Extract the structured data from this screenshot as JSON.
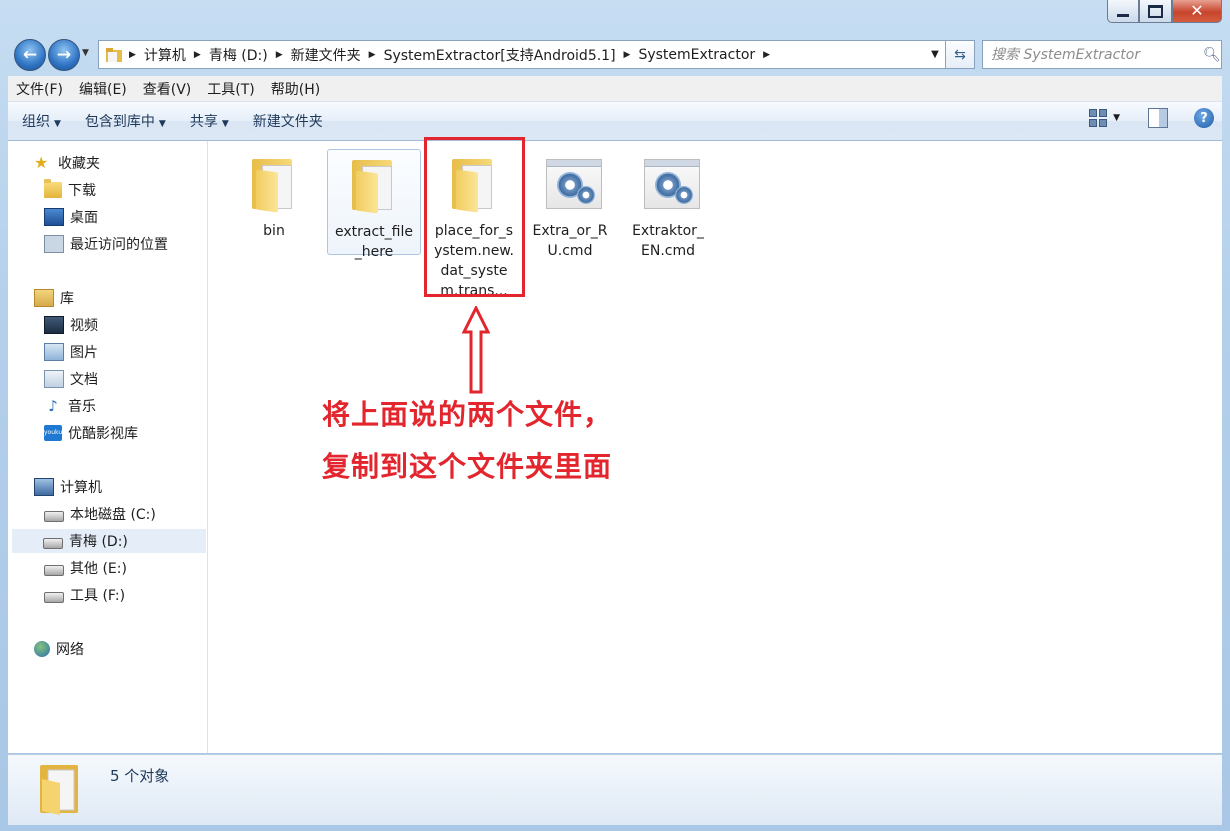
{
  "window": {
    "minimize": "minimize",
    "maximize": "maximize",
    "close": "✕"
  },
  "nav": {
    "back_icon": "back-arrow-icon",
    "forward_icon": "forward-arrow-icon",
    "breadcrumb": [
      "计算机",
      "青梅 (D:)",
      "新建文件夹",
      "SystemExtractor[支持Android5.1]",
      "SystemExtractor"
    ],
    "search_placeholder": "搜索 SystemExtractor"
  },
  "menu": [
    "文件(F)",
    "编辑(E)",
    "查看(V)",
    "工具(T)",
    "帮助(H)"
  ],
  "toolbar": {
    "organize": "组织",
    "include_library": "包含到库中",
    "share": "共享",
    "new_folder": "新建文件夹"
  },
  "sidebar": {
    "favorites": "收藏夹",
    "downloads": "下载",
    "desktop": "桌面",
    "recent": "最近访问的位置",
    "libraries": "库",
    "videos": "视频",
    "pictures": "图片",
    "documents": "文档",
    "music": "音乐",
    "youku": "优酷影视库",
    "youku_logo_text": "youku",
    "computer": "计算机",
    "drive_c": "本地磁盘 (C:)",
    "drive_d": "青梅 (D:)",
    "drive_e": "其他 (E:)",
    "drive_f": "工具 (F:)",
    "network": "网络"
  },
  "files": [
    {
      "name": "bin",
      "type": "folder"
    },
    {
      "name": "extract_file_here",
      "type": "folder"
    },
    {
      "name": "place_for_system.new.dat_system.trans...",
      "type": "folder"
    },
    {
      "name": "Extra_or_RU.cmd",
      "type": "cmd"
    },
    {
      "name": "Extraktor_EN.cmd",
      "type": "cmd"
    }
  ],
  "annotation": {
    "line1": "将上面说的两个文件，",
    "line2": "复制到这个文件夹里面",
    "color": "#e3262e"
  },
  "status": {
    "count": "5 个对象"
  }
}
